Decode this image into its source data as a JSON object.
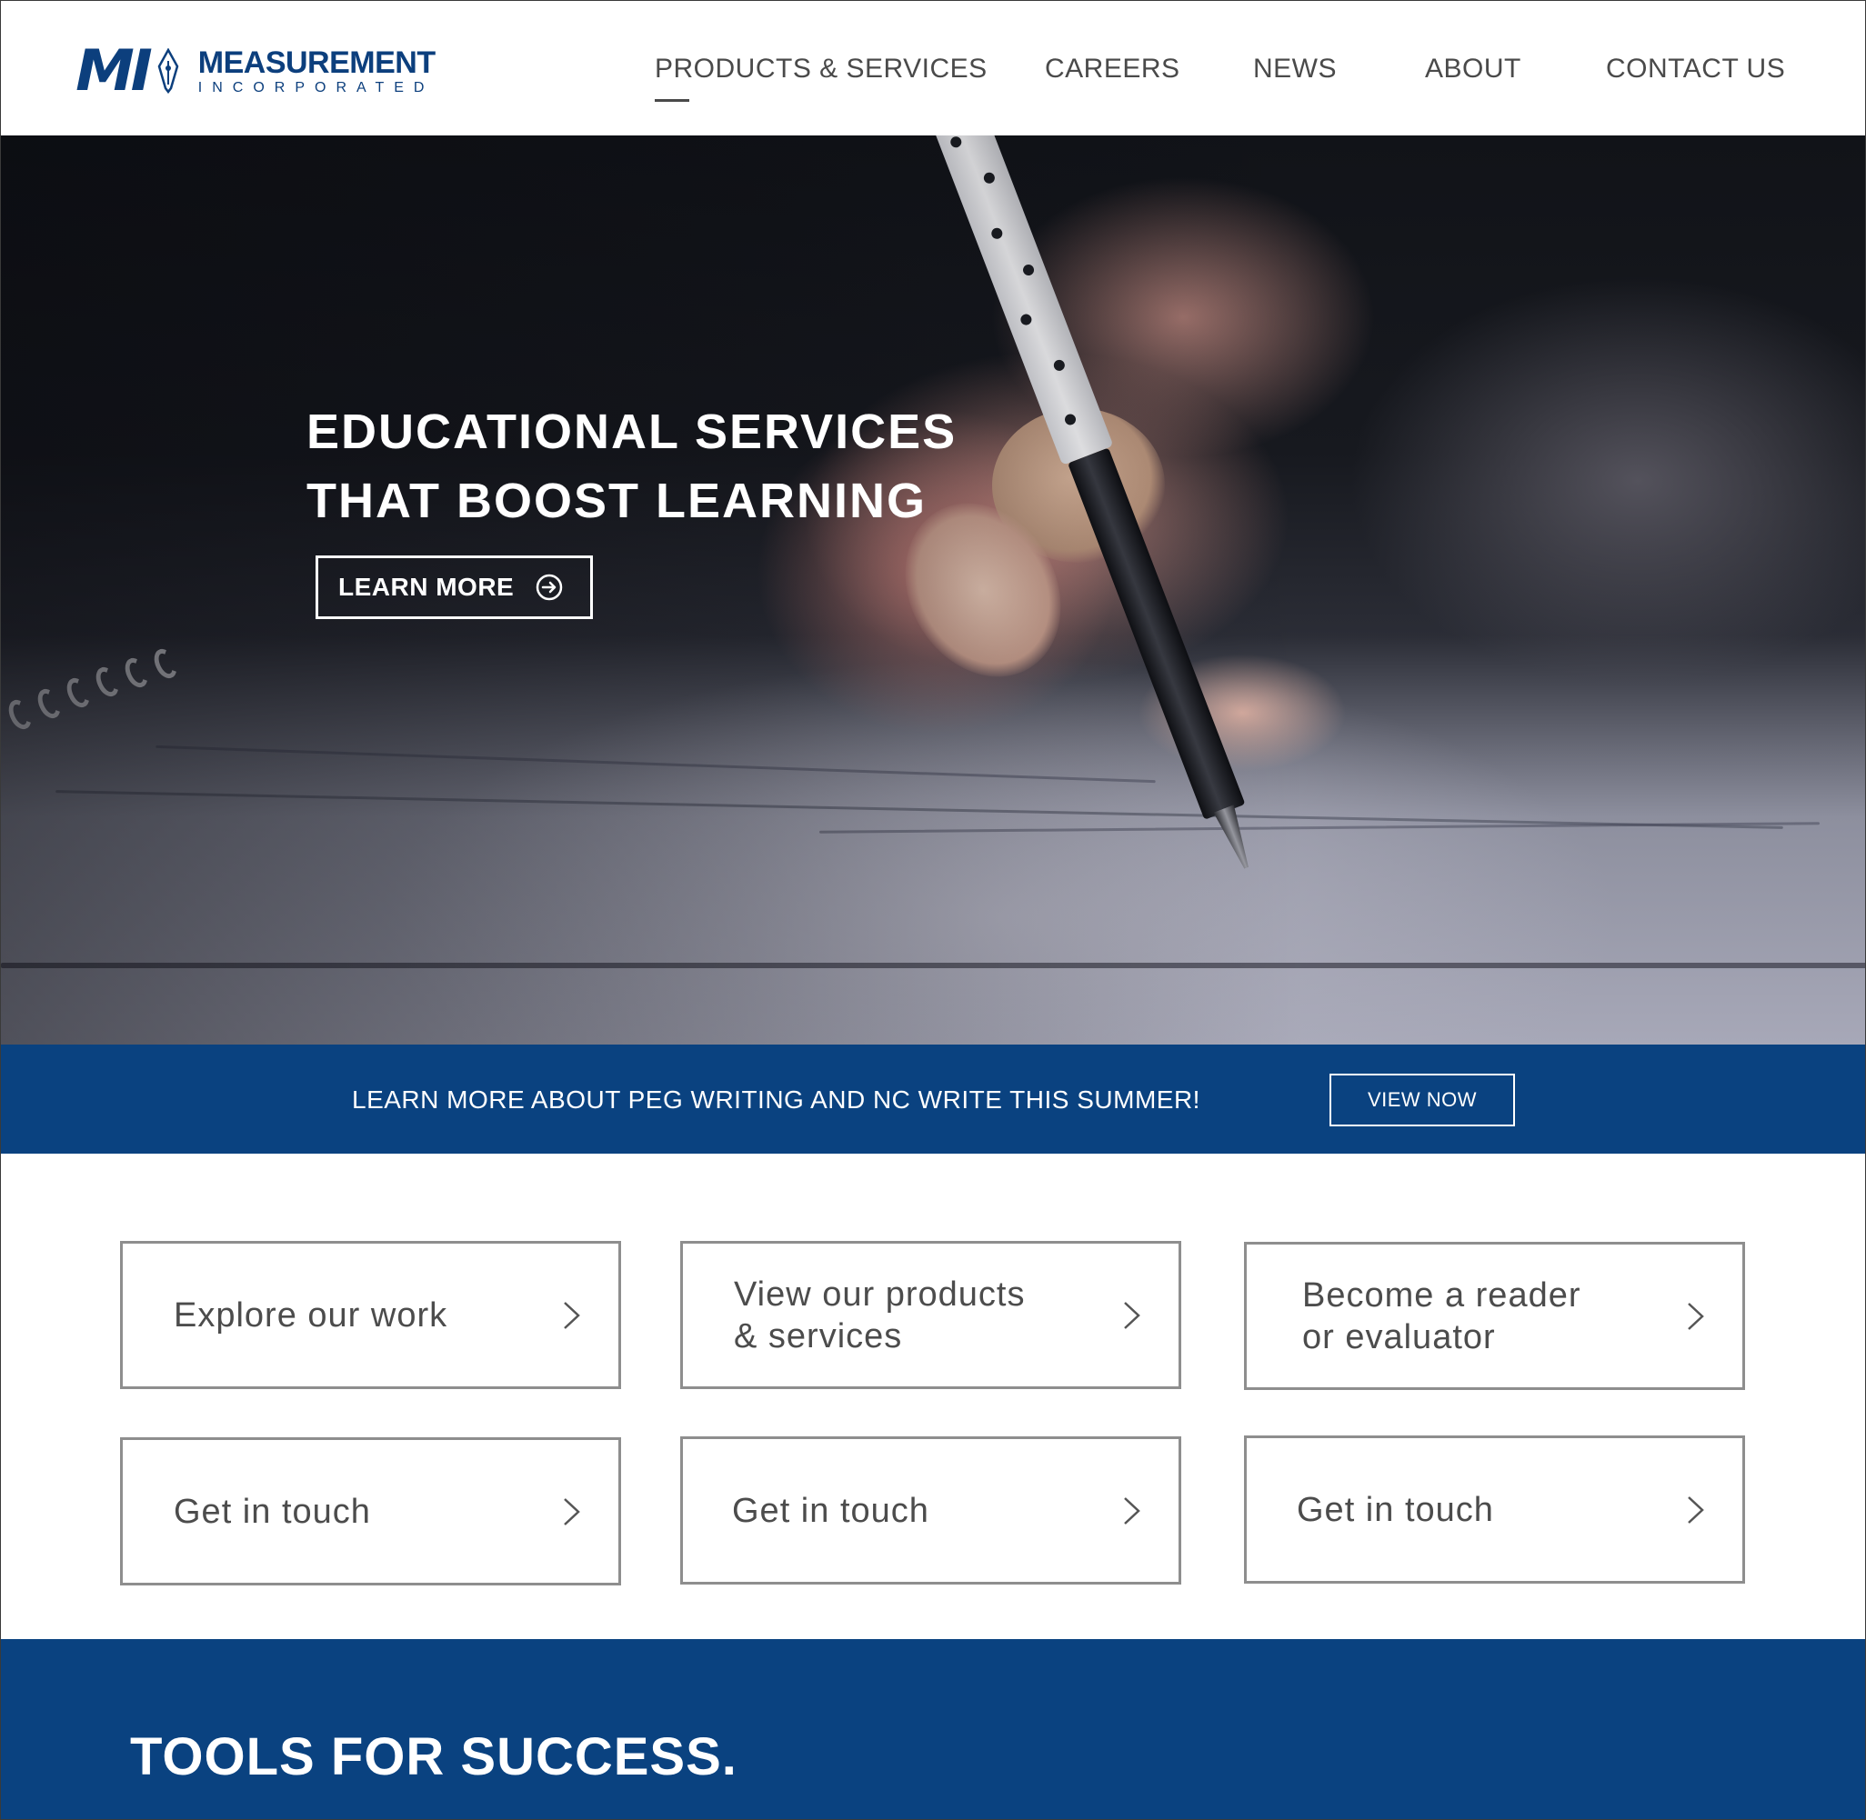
{
  "brand": {
    "logo_mark": "MI",
    "name": "MEASUREMENT",
    "subtitle": "INCORPORATED",
    "color": "#0c3f7d"
  },
  "nav": {
    "items": [
      {
        "label": "PRODUCTS & SERVICES",
        "active": true
      },
      {
        "label": "CAREERS",
        "active": false
      },
      {
        "label": "NEWS",
        "active": false
      },
      {
        "label": "ABOUT",
        "active": false
      },
      {
        "label": "CONTACT US",
        "active": false
      }
    ]
  },
  "hero": {
    "title_line1": "EDUCATIONAL SERVICES",
    "title_line2": "THAT BOOST LEARNING",
    "cta_label": "LEARN MORE",
    "cta_icon": "arrow-circle-right-icon"
  },
  "banner": {
    "text": "LEARN MORE ABOUT PEG WRITING AND NC WRITE THIS SUMMER!",
    "button_label": "VIEW NOW",
    "color": "#0a4280"
  },
  "cards": [
    {
      "line1": "Explore our work",
      "line2": ""
    },
    {
      "line1": "View our products",
      "line2": "& services"
    },
    {
      "line1": "Become a reader",
      "line2": "or evaluator"
    },
    {
      "line1": "Get in touch",
      "line2": ""
    },
    {
      "line1": "Get in touch",
      "line2": ""
    },
    {
      "line1": "Get in touch",
      "line2": ""
    }
  ],
  "card_icon": "chevron-right-icon",
  "tools": {
    "title": "TOOLS FOR SUCCESS."
  }
}
